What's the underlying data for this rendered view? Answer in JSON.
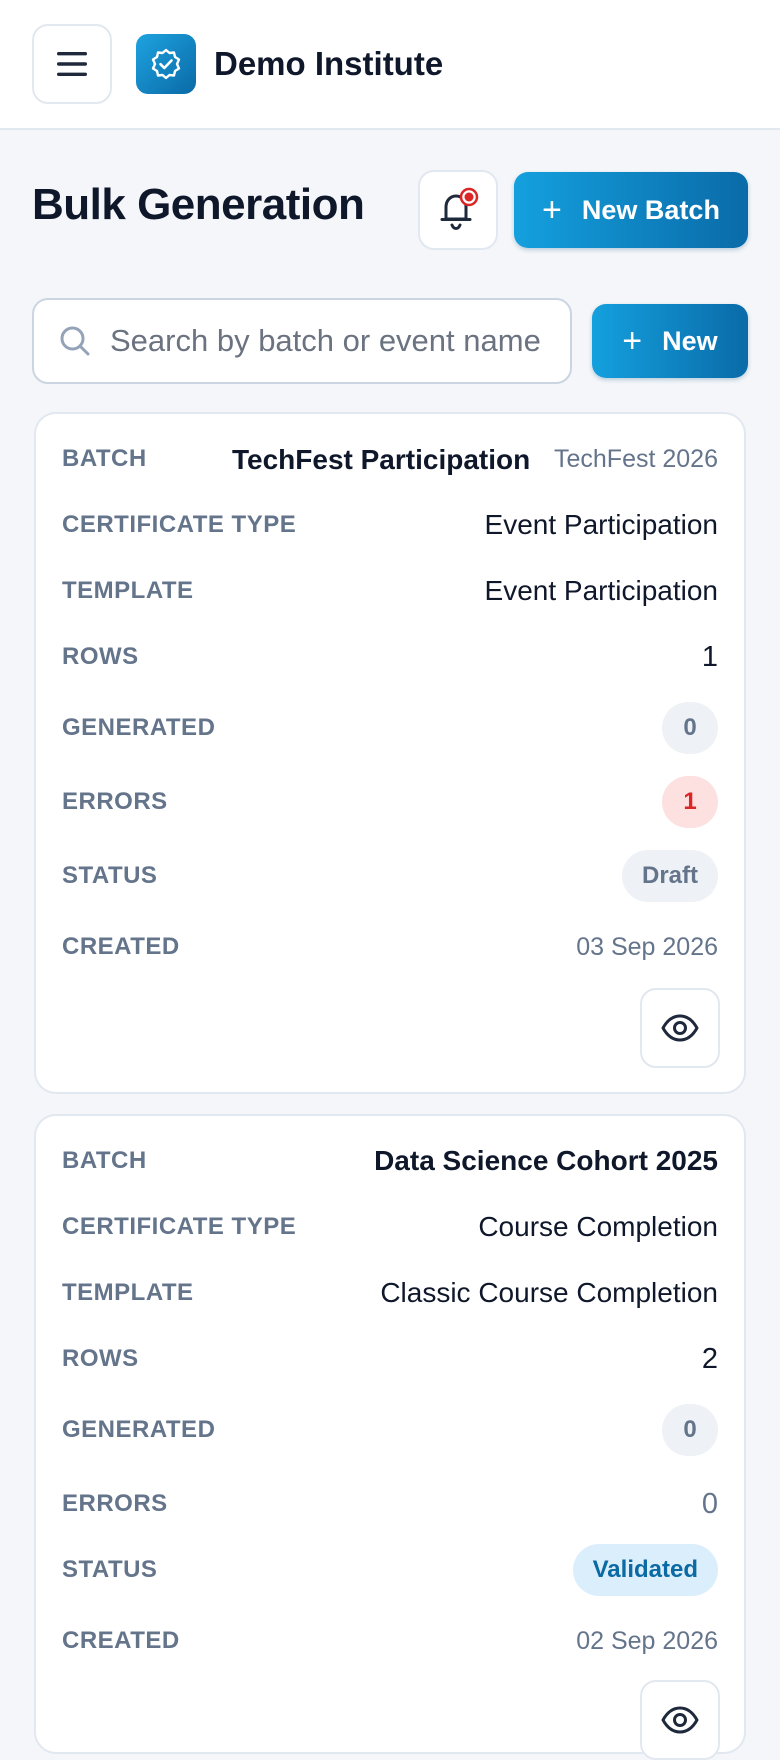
{
  "topbar": {
    "brand": "Demo Institute",
    "menu_icon": "hamburger-menu-icon",
    "logo_icon": "verified-badge-icon"
  },
  "page": {
    "title": "Bulk Generation",
    "bell_icon": "notification-bell-icon",
    "new_batch_label": "New Batch",
    "new_label": "New"
  },
  "search": {
    "placeholder": "Search by batch or event name",
    "value": ""
  },
  "labels": {
    "batch": "BATCH",
    "certificate_type": "CERTIFICATE TYPE",
    "template": "TEMPLATE",
    "rows": "ROWS",
    "generated": "GENERATED",
    "errors": "ERRORS",
    "status": "STATUS",
    "created": "CREATED"
  },
  "batches": [
    {
      "name": "TechFest Participation",
      "event": "TechFest 2026",
      "certificate_type": "Event Participation",
      "template": "Event Participation",
      "rows": "1",
      "generated": "0",
      "errors": "1",
      "status": "Draft",
      "created": "03 Sep 2026"
    },
    {
      "name": "Data Science Cohort 2025",
      "certificate_type": "Course Completion",
      "template": "Classic Course Completion",
      "rows": "2",
      "generated": "0",
      "errors": "0",
      "status": "Validated",
      "created": "02 Sep 2026"
    }
  ],
  "colors": {
    "accent_start": "#14a0de",
    "accent_end": "#0a6ba8",
    "error": "#dc2626",
    "notification_dot": "#dc2626"
  }
}
